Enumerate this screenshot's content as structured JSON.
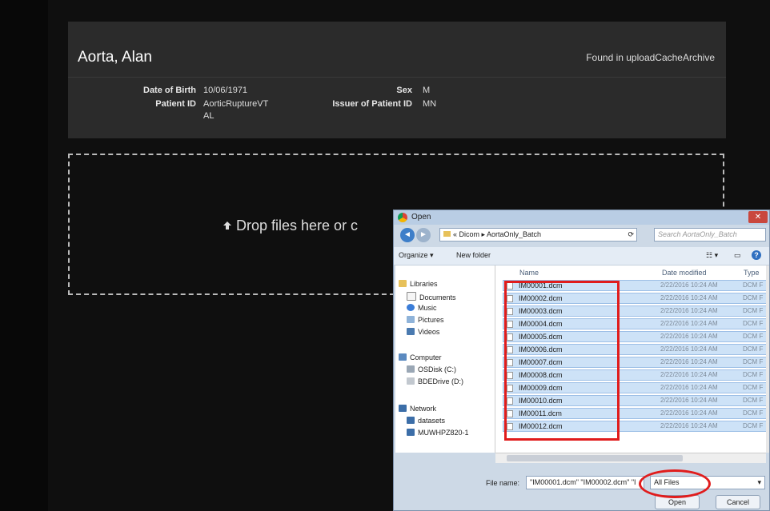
{
  "patient": {
    "name": "Aorta, Alan",
    "found_text": "Found in uploadCacheArchive",
    "dob_label": "Date of Birth",
    "dob": "10/06/1971",
    "pid_label": "Patient ID",
    "pid_line1": "AorticRuptureVT",
    "pid_line2": "AL",
    "sex_label": "Sex",
    "sex": "M",
    "issuer_label": "Issuer of Patient ID",
    "issuer": "MN"
  },
  "dropzone": {
    "icon": "upload-arrow-icon",
    "text": "Drop files here or c"
  },
  "dialog": {
    "title": "Open",
    "close": "✕",
    "address": "« Dicom ▸ AortaOnly_Batch",
    "search_placeholder": "Search AortaOnly_Batch",
    "organize": "Organize ▾",
    "new_folder": "New folder",
    "columns": {
      "name": "Name",
      "date": "Date modified",
      "type": "Type"
    },
    "nav": {
      "libraries": "Libraries",
      "documents": "Documents",
      "music": "Music",
      "pictures": "Pictures",
      "videos": "Videos",
      "computer": "Computer",
      "osdisk": "OSDisk (C:)",
      "bdedrive": "BDEDrive (D:)",
      "network": "Network",
      "datasets": "datasets",
      "muwhpz": "MUWHPZ820-1"
    },
    "files": [
      {
        "name": "IM00001.dcm",
        "date": "2/22/2016 10:24 AM",
        "type": "DCM F"
      },
      {
        "name": "IM00002.dcm",
        "date": "2/22/2016 10:24 AM",
        "type": "DCM F"
      },
      {
        "name": "IM00003.dcm",
        "date": "2/22/2016 10:24 AM",
        "type": "DCM F"
      },
      {
        "name": "IM00004.dcm",
        "date": "2/22/2016 10:24 AM",
        "type": "DCM F"
      },
      {
        "name": "IM00005.dcm",
        "date": "2/22/2016 10:24 AM",
        "type": "DCM F"
      },
      {
        "name": "IM00006.dcm",
        "date": "2/22/2016 10:24 AM",
        "type": "DCM F"
      },
      {
        "name": "IM00007.dcm",
        "date": "2/22/2016 10:24 AM",
        "type": "DCM F"
      },
      {
        "name": "IM00008.dcm",
        "date": "2/22/2016 10:24 AM",
        "type": "DCM F"
      },
      {
        "name": "IM00009.dcm",
        "date": "2/22/2016 10:24 AM",
        "type": "DCM F"
      },
      {
        "name": "IM00010.dcm",
        "date": "2/22/2016 10:24 AM",
        "type": "DCM F"
      },
      {
        "name": "IM00011.dcm",
        "date": "2/22/2016 10:24 AM",
        "type": "DCM F"
      },
      {
        "name": "IM00012.dcm",
        "date": "2/22/2016 10:24 AM",
        "type": "DCM F"
      }
    ],
    "file_name_label": "File name:",
    "file_name_value": "\"IM00001.dcm\" \"IM00002.dcm\" \"I",
    "filter": "All Files",
    "open_button": "Open",
    "cancel_button": "Cancel"
  },
  "colors": {
    "highlight": "#e01c1c",
    "selection": "#cde2f7"
  }
}
